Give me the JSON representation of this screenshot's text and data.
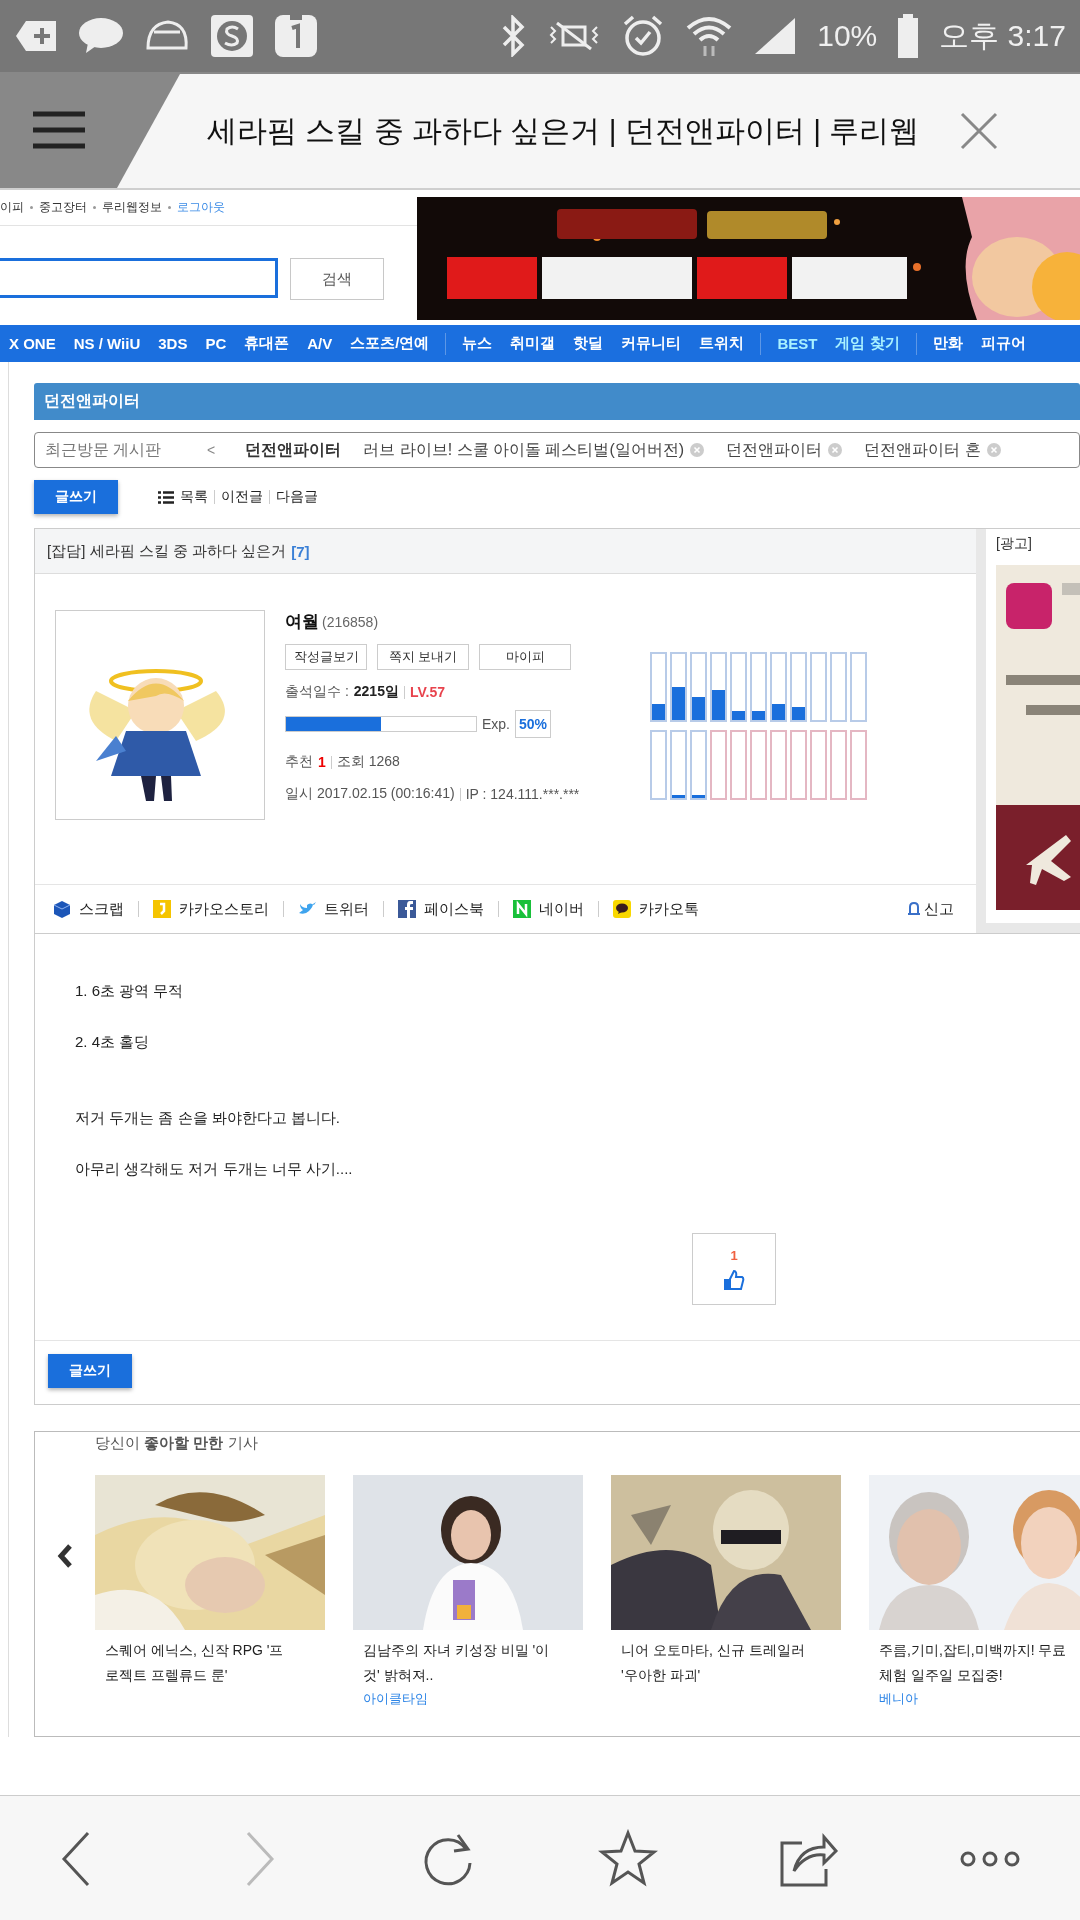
{
  "status_bar": {
    "battery": "10%",
    "time": "오후 3:17"
  },
  "browser_tab": {
    "title": "세라핌 스킬 중 과하다 싶은거 | 던전앤파이터 | 루리웹"
  },
  "top_links": [
    {
      "label": "이피",
      "kind": "text"
    },
    {
      "label": "중고장터",
      "kind": "text"
    },
    {
      "label": "루리웹정보",
      "kind": "text"
    },
    {
      "label": "로그아웃",
      "kind": "link"
    }
  ],
  "search": {
    "button": "검색"
  },
  "nav_groups": [
    {
      "items": [
        {
          "label": "X ONE",
          "highlighted": false
        },
        {
          "label": "NS / WiiU",
          "highlighted": false
        },
        {
          "label": "3DS",
          "highlighted": false
        },
        {
          "label": "PC",
          "highlighted": false
        },
        {
          "label": "휴대폰",
          "highlighted": false
        },
        {
          "label": "A/V",
          "highlighted": false
        },
        {
          "label": "스포츠/연예",
          "highlighted": false
        }
      ]
    },
    {
      "items": [
        {
          "label": "뉴스",
          "highlighted": false
        },
        {
          "label": "취미갤",
          "highlighted": false
        },
        {
          "label": "핫딜",
          "highlighted": false
        },
        {
          "label": "커뮤니티",
          "highlighted": false
        },
        {
          "label": "트위치",
          "highlighted": false
        }
      ]
    },
    {
      "items": [
        {
          "label": "BEST",
          "highlighted": true
        },
        {
          "label": "게임 찾기",
          "highlighted": true
        }
      ]
    },
    {
      "items": [
        {
          "label": "만화",
          "highlighted": false
        },
        {
          "label": "피규어",
          "highlighted": false
        }
      ]
    }
  ],
  "board_title": "던전앤파이터",
  "recent_boards": {
    "label": "최근방문 게시판",
    "prev": "<",
    "items": [
      {
        "label": "던전앤파이터",
        "selected": true
      },
      {
        "label": "러브 라이브! 스쿨 아이돌 페스티벌(일어버전)",
        "selected": false
      },
      {
        "label": "던전앤파이터",
        "selected": false
      },
      {
        "label": "던전앤파이터 혼",
        "selected": false
      }
    ]
  },
  "toolbar": {
    "write": "글쓰기",
    "links": [
      "목록",
      "이전글",
      "다음글"
    ]
  },
  "post": {
    "category": "[잡담]",
    "title": "세라핌 스킬 중 과하다 싶은거",
    "comment_count": "[7]",
    "author": {
      "name": "여월",
      "id": "(216858)"
    },
    "profile_buttons": [
      "작성글보기",
      "쪽지 보내기",
      "마이피"
    ],
    "attendance_label": "출석일수 :",
    "attendance": "2215일",
    "user_level": "LV.57",
    "exp_bar": {
      "level": 0.5
    },
    "exp_label": "Exp.",
    "exp_percent": "50%",
    "recommend_label": "추천",
    "recommend": "1",
    "views": "조회 1268",
    "date": "일시 2017.02.15 (00:16:41)",
    "ip": "IP : 124.111.***.***",
    "activity": [
      {
        "bars": [
          {
            "level": 0.25,
            "color": "#b8cbe8"
          },
          {
            "level": 0.5,
            "color": "#b8cbe8"
          },
          {
            "level": 0.35,
            "color": "#b8cbe8"
          },
          {
            "level": 0.45,
            "color": "#b8cbe8"
          },
          {
            "level": 0.14,
            "color": "#b8cbe8"
          },
          {
            "level": 0.14,
            "color": "#b8cbe8"
          },
          {
            "level": 0.25,
            "color": "#b8cbe8"
          },
          {
            "level": 0.2,
            "color": "#b8cbe8"
          },
          {
            "color": "#b8cbe8"
          },
          {
            "color": "#b8cbe8"
          },
          {
            "color": "#b8cbe8"
          }
        ]
      },
      {
        "bars": [
          {
            "color": "#b8cbe8"
          },
          {
            "level": 0.04,
            "color": "#b8cbe8"
          },
          {
            "level": 0.04,
            "color": "#b8cbe8"
          },
          {
            "color": "#e4b7c3"
          },
          {
            "color": "#e4b7c3"
          },
          {
            "color": "#e4b7c3"
          },
          {
            "color": "#e4b7c3"
          },
          {
            "color": "#e4b7c3"
          },
          {
            "color": "#e4b7c3"
          },
          {
            "color": "#e4b7c3"
          },
          {
            "color": "#e4b7c3"
          }
        ]
      }
    ],
    "share": [
      {
        "label": "스크랩",
        "kind": "scrap"
      },
      {
        "label": "카카오스토리",
        "kind": "kakaostory"
      },
      {
        "label": "트위터",
        "kind": "twitter"
      },
      {
        "label": "페이스북",
        "kind": "facebook"
      },
      {
        "label": "네이버",
        "kind": "naver"
      },
      {
        "label": "카카오톡",
        "kind": "kakaotalk"
      }
    ],
    "report": "신고",
    "body": [
      {
        "paragraphs": [
          "1. 6초 광역 무적",
          "2. 4초 홀딩"
        ]
      },
      {
        "paragraphs": [
          "저거 두개는 좀 손을 봐야한다고 봅니다.",
          "아무리 생각해도 저거 두개는 너무 사기...."
        ]
      }
    ],
    "like_count": "1",
    "bottom_write": "글쓰기"
  },
  "ad": {
    "label": "[광고]"
  },
  "recommended": {
    "heading": "당신이 **좋아할 만한** 기사",
    "articles": [
      {
        "title": "스퀘어 에닉스, 신작 RPG '프로젝트 프렐류드 룬'"
      },
      {
        "title": "김남주의 자녀 키성장 비밀 '이것' 밝혀져..",
        "source": "아이클타임"
      },
      {
        "title": "니어 오토마타, 신규 트레일러 '우아한 파괴'"
      },
      {
        "title": "주름,기미,잡티,미백까지! 무료 체험 일주일 모집중!",
        "source": "베니아"
      }
    ]
  },
  "browser_nav": [
    {
      "kind": "back",
      "disabled": false
    },
    {
      "kind": "forward",
      "disabled": true
    },
    {
      "kind": "reload",
      "disabled": false
    },
    {
      "kind": "bookmark",
      "disabled": false
    },
    {
      "kind": "share",
      "disabled": false
    },
    {
      "kind": "more",
      "disabled": false
    }
  ]
}
